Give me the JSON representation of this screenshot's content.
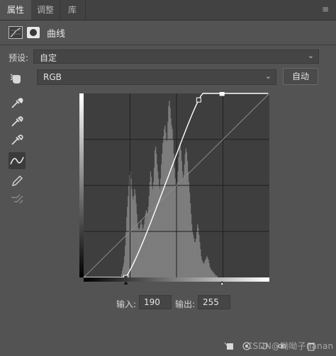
{
  "tabs": [
    {
      "label": "属性"
    },
    {
      "label": "调整"
    },
    {
      "label": "库"
    }
  ],
  "header": {
    "title": "曲线"
  },
  "preset": {
    "label": "预设:",
    "value": "自定"
  },
  "channel": {
    "value": "RGB"
  },
  "auto_button": {
    "label": "自动"
  },
  "io": {
    "input_label": "输入:",
    "input_value": "190",
    "output_label": "输出:",
    "output_value": "255"
  },
  "curve": {
    "points": [
      [
        0,
        0
      ],
      [
        58,
        0
      ],
      [
        158,
        246
      ],
      [
        190,
        255
      ],
      [
        255,
        255
      ]
    ],
    "selected_point": [
      190,
      255
    ]
  },
  "histogram_levels": [
    0,
    0,
    0,
    0,
    0,
    0,
    0,
    0,
    0,
    0,
    0,
    0,
    0,
    0,
    0,
    0,
    0,
    0,
    0,
    0,
    0,
    0,
    0,
    0,
    0,
    0,
    0,
    0,
    0,
    0,
    0,
    0,
    0,
    0,
    0,
    0,
    0,
    0,
    0,
    0,
    0,
    0,
    0,
    0,
    0,
    0,
    0,
    0,
    0,
    0,
    0,
    0,
    0.02,
    0.04,
    0.06,
    0.08,
    0.12,
    0.18,
    0.26,
    0.34,
    0.4,
    0.46,
    0.52,
    0.58,
    0.6,
    0.56,
    0.5,
    0.46,
    0.44,
    0.46,
    0.5,
    0.47,
    0.42,
    0.36,
    0.3,
    0.28,
    0.27,
    0.28,
    0.3,
    0.32,
    0.3,
    0.27,
    0.28,
    0.3,
    0.33,
    0.36,
    0.38,
    0.37,
    0.36,
    0.4,
    0.46,
    0.54,
    0.6,
    0.57,
    0.52,
    0.5,
    0.54,
    0.62,
    0.72,
    0.74,
    0.7,
    0.64,
    0.6,
    0.56,
    0.52,
    0.5,
    0.56,
    0.64,
    0.7,
    0.76,
    0.8,
    0.84,
    0.86,
    0.82,
    0.77,
    0.78,
    0.88,
    0.97,
    1.0,
    0.96,
    0.9,
    0.86,
    0.84,
    0.78,
    0.7,
    0.62,
    0.56,
    0.52,
    0.5,
    0.54,
    0.6,
    0.68,
    0.74,
    0.76,
    0.72,
    0.66,
    0.6,
    0.56,
    0.58,
    0.64,
    0.7,
    0.73,
    0.71,
    0.66,
    0.6,
    0.54,
    0.48,
    0.42,
    0.36,
    0.3,
    0.26,
    0.24,
    0.22,
    0.2,
    0.2,
    0.22,
    0.26,
    0.3,
    0.28,
    0.24,
    0.2,
    0.16,
    0.12,
    0.1,
    0.09,
    0.08,
    0.08,
    0.09,
    0.1,
    0.11,
    0.12,
    0.11,
    0.1,
    0.08,
    0.06,
    0.05,
    0.04,
    0.04,
    0.03,
    0.03,
    0.02,
    0.02,
    0.01,
    0.01,
    0.01,
    0,
    0,
    0,
    0,
    0,
    0,
    0,
    0,
    0,
    0,
    0,
    0,
    0,
    0,
    0,
    0,
    0,
    0,
    0,
    0,
    0,
    0,
    0,
    0,
    0,
    0,
    0,
    0,
    0,
    0,
    0,
    0,
    0,
    0,
    0,
    0,
    0,
    0,
    0,
    0,
    0,
    0,
    0,
    0,
    0,
    0,
    0,
    0,
    0,
    0,
    0,
    0,
    0,
    0,
    0,
    0,
    0,
    0,
    0,
    0,
    0,
    0,
    0,
    0,
    0,
    0,
    0,
    0,
    0,
    0,
    0,
    0
  ],
  "footer": {
    "watermark": "CSDN@呦呦子nanan"
  }
}
